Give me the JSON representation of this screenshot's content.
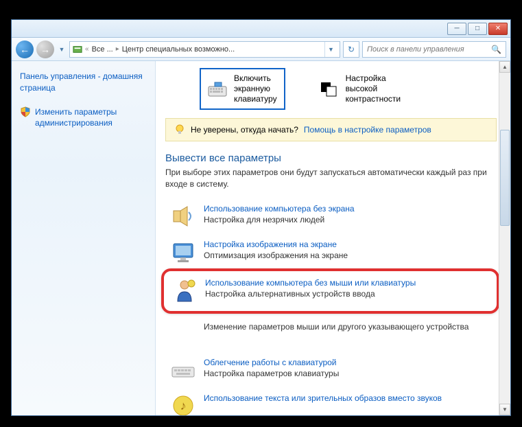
{
  "breadcrumb": {
    "part1": "Все ...",
    "part2": "Центр специальных возможно..."
  },
  "search": {
    "placeholder": "Поиск в панели управления"
  },
  "sidebar": {
    "home": "Панель управления - домашняя страница",
    "admin": "Изменить параметры администрирования"
  },
  "tiles": {
    "keyboard": "Включить\nэкранную\nклавиатуру",
    "contrast": "Настройка\nвысокой\nконтрастности"
  },
  "hint": {
    "text": "Не уверены, откуда начать?",
    "link": "Помощь в настройке параметров"
  },
  "heading": "Вывести все параметры",
  "subtext": "При выборе этих параметров они будут запускаться автоматически каждый раз при входе в систему.",
  "options": [
    {
      "title": "Использование компьютера без экрана",
      "desc": "Настройка для незрячих людей"
    },
    {
      "title": "Настройка изображения на экране",
      "desc": "Оптимизация изображения на экране"
    },
    {
      "title": "Использование компьютера без мыши или клавиатуры",
      "desc": "Настройка альтернативных устройств ввода"
    },
    {
      "title": "",
      "desc": "Изменение параметров мыши или другого указывающего устройства"
    },
    {
      "title": "Облегчение работы с клавиатурой",
      "desc": "Настройка параметров клавиатуры"
    },
    {
      "title": "Использование текста или зрительных образов вместо звуков",
      "desc": ""
    }
  ]
}
